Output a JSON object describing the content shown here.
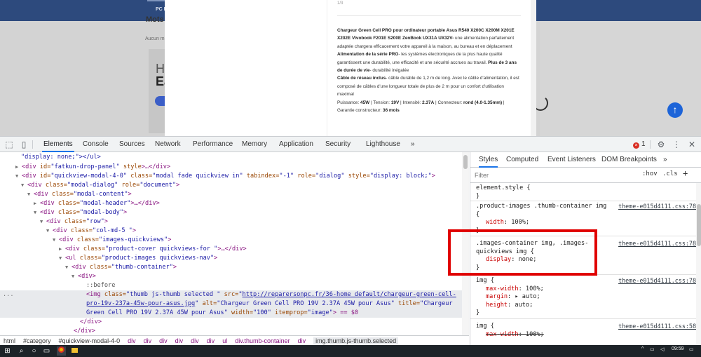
{
  "page": {
    "nav_label": "PC R",
    "left_title": "Mots",
    "left_subtitle": "Aucun m",
    "hero_line1": "H",
    "hero_line2": "Ea",
    "scroll_up_icon": "arrow-up-icon"
  },
  "modal": {
    "top_text": "1/3",
    "description": {
      "p1_bold": "Chargeur Green Cell PRO pour ordinateur portable Asus R540 X200C X200M X201E X202E Vivobook F201E S200E ZenBook UX31A UX32V-",
      "p1_text": " une alimentation parfaitement adaptée chargera efficacement votre appareil à la maison, au bureau et en déplacement",
      "p2_bold": "Alimentation de la série PRO",
      "p2_text": "- les systèmes électroniques de la plus haute qualité garantissent une durabilité, une efficacité et une sécurité accrues au travail.",
      "p2_bold2": " Plus de 3 ans de durée de vie",
      "p2_text2": "- durabilité inégalée",
      "p3_bold": "Câble de réseau inclus",
      "p3_text": "- câble durable de 1,2 m de long. Avec le câble d'alimentation, il est composé de câbles d'une longueur totale de plus de 2 m pour un confort d'utilisation maximal",
      "p4_a": "Puissance: ",
      "p4_b": "45W",
      "p4_c": " | Tension: ",
      "p4_d": "19V",
      "p4_e": " | Intensité: ",
      "p4_f": "2.37A",
      "p4_g": " | Connecteur: ",
      "p4_h": "rond (4.0-1.35mm)",
      "p4_i": " | Garantie constructeur: ",
      "p4_j": "36 mois"
    }
  },
  "devtools": {
    "tabs": [
      "Elements",
      "Console",
      "Sources",
      "Network",
      "Performance",
      "Memory",
      "Application",
      "Security",
      "Lighthouse"
    ],
    "more_tabs": "»",
    "error_count": "1",
    "elements": {
      "l0": "\"display: none;\"></ul>",
      "l1_tag": "<div",
      "l1_an": " id=",
      "l1_av": "\"fatkun-drop-panel\"",
      "l1_an2": " style",
      "l1_rest": ">…</div>",
      "l2": [
        "<div",
        " id=",
        "\"quickview-modal-4-0\"",
        " class=",
        "\"modal fade quickview in\"",
        " tabindex=",
        "\"-1\"",
        " role=",
        "\"dialog\"",
        " style=",
        "\"display: block;\"",
        ">"
      ],
      "l3": [
        "<div",
        " class=",
        "\"modal-dialog\"",
        " role=",
        "\"document\"",
        ">"
      ],
      "l4": [
        "<div",
        " class=",
        "\"modal-content\"",
        ">"
      ],
      "l5": [
        "<div",
        " class=",
        "\"modal-header\"",
        ">…</div>"
      ],
      "l6": [
        "<div",
        " class=",
        "\"modal-body\"",
        ">"
      ],
      "l7": [
        "<div",
        " class=",
        "\"row\"",
        ">"
      ],
      "l8": [
        "<div",
        " class=",
        "\"col-md-5 \"",
        ">"
      ],
      "l9": [
        "<div",
        " class=",
        "\"images-quickviews\"",
        ">"
      ],
      "l10": [
        "<div",
        " class=",
        "\"product-cover quickviews-for \"",
        ">…</div>"
      ],
      "l11": [
        "<ul",
        " class=",
        "\"product-images quickviews-nav\"",
        ">"
      ],
      "l12": [
        "<div",
        " class=",
        "\"thumb-container\"",
        ">"
      ],
      "l13": "<div>",
      "l14": "::before",
      "l15_a": "<img",
      "l15_b": " class=",
      "l15_c": "\"thumb js-thumb  selected \"",
      "l15_d": " src=",
      "l15_e": "\"",
      "l15_link1": "http://reparersonpc.fr/36-home_default/chargeur-green-cell-",
      "l16_link2": "pro-19v-237a-45w-pour-asus.jpg",
      "l16_b": "\"",
      "l16_c": " alt=",
      "l16_d": "\"Chargeur Green Cell PRO 19V 2.37A 45W pour Asus\"",
      "l16_e": " title=",
      "l16_f": "\"Chargeur",
      "l17_a": "Green Cell PRO 19V 2.37A 45W pour Asus\"",
      "l17_b": " width=",
      "l17_c": "\"100\"",
      "l17_d": " itemprop=",
      "l17_e": "\"image\"",
      "l17_f": "> == $0",
      "l18": "</div>",
      "l19": "</div>",
      "dots": "..."
    },
    "breadcrumbs": [
      "html",
      "#category",
      "#quickview-modal-4-0",
      "div",
      "div",
      "div",
      "div",
      "div",
      "div",
      "ul",
      "div.thumb-container",
      "div",
      "img.thumb.js-thumb.selected"
    ],
    "styles_tabs": [
      "Styles",
      "Computed",
      "Event Listeners",
      "DOM Breakpoints",
      "»"
    ],
    "filter_placeholder": "Filter",
    "hov": ":hov",
    "cls": ".cls",
    "plus": "+",
    "rules": {
      "r0_sel": "element.style {",
      "r0_end": "}",
      "r1_sel": ".product-images .thumb-container img",
      "r1_open": "{",
      "r1_src": "theme-e015d4111.css:78",
      "r1_p": "width",
      "r1_v": ": 100%;",
      "r1_end": "}",
      "r2_sel1": ".images-container img, .images-",
      "r2_sel2": "quickviews img {",
      "r2_src": "theme-e015d4111.css:78",
      "r2_p": "display",
      "r2_v": ": none;",
      "r2_end": "}",
      "r3_sel": "img {",
      "r3_src": "theme-e015d4111.css:78",
      "r3_p1": "max-width",
      "r3_v1": ": 100%;",
      "r3_p2": "margin",
      "r3_v2": ": ▸ auto;",
      "r3_p3": "height",
      "r3_v3": ": auto;",
      "r3_end": "}",
      "r4_sel": "img {",
      "r4_src": "theme-e015d4111.css:58",
      "r4_p": "max-width",
      "r4_v": ": 100%;"
    }
  },
  "taskbar": {
    "time": "09:59",
    "date": "",
    "icons": [
      "windows-icon",
      "search-icon",
      "task-view-icon",
      "chrome-icon",
      "file-explorer-icon"
    ]
  },
  "colors": {
    "accent": "#1a73e8",
    "highlight_box": "#e00000",
    "tag": "#881280",
    "attr_name": "#994500",
    "attr_value": "#1a1aa6",
    "css_prop": "#c80000"
  }
}
